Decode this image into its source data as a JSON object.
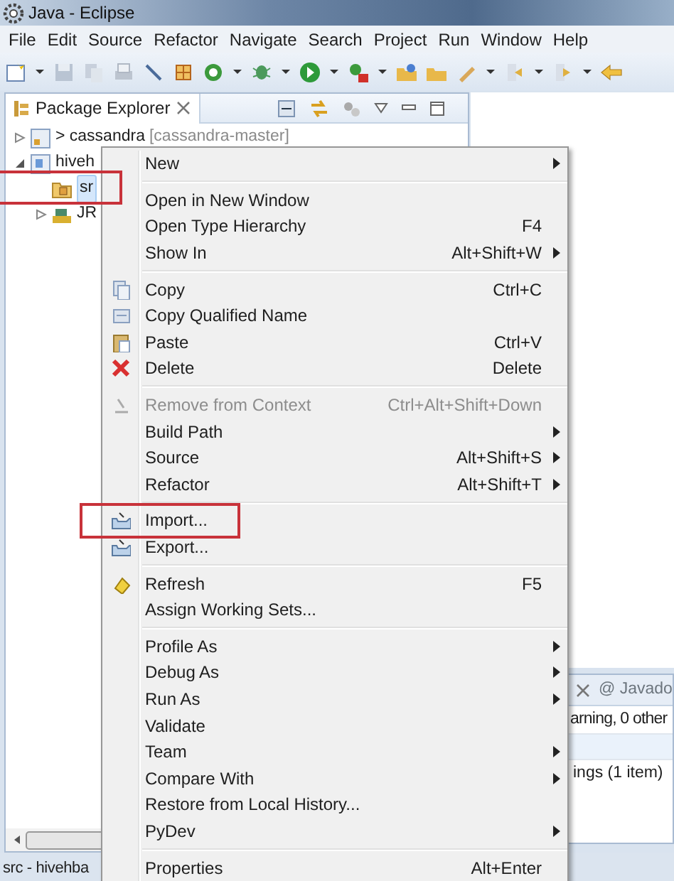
{
  "window": {
    "title": "Java - Eclipse"
  },
  "menu_bar": [
    "File",
    "Edit",
    "Source",
    "Refactor",
    "Navigate",
    "Search",
    "Project",
    "Run",
    "Window",
    "Help"
  ],
  "package_explorer": {
    "title": "Package Explorer",
    "tree": [
      {
        "label": "> cassandra",
        "suffix": "[cassandra-master]",
        "expanded": false,
        "selected": false,
        "highlighted": false
      },
      {
        "label": "hiveh",
        "expanded": true,
        "selected": false,
        "highlighted": false,
        "children": [
          {
            "label": "sr",
            "selected": true,
            "highlighted": true
          },
          {
            "label": "JR",
            "expanded": false,
            "selected": false,
            "highlighted": false
          }
        ]
      }
    ]
  },
  "context_menu": {
    "groups": [
      [
        {
          "label": "New",
          "submenu": true,
          "disabled": false,
          "highlighted": false
        }
      ],
      [
        {
          "label": "Open in New Window",
          "submenu": false,
          "disabled": false,
          "highlighted": false
        },
        {
          "label": "Open Type Hierarchy",
          "shortcut": "F4",
          "submenu": false,
          "disabled": false,
          "highlighted": false
        },
        {
          "label": "Show In",
          "shortcut": "Alt+Shift+W",
          "submenu": true,
          "disabled": false,
          "highlighted": false
        }
      ],
      [
        {
          "label": "Copy",
          "shortcut": "Ctrl+C",
          "submenu": false,
          "disabled": false,
          "highlighted": false
        },
        {
          "label": "Copy Qualified Name",
          "submenu": false,
          "disabled": false,
          "highlighted": false
        },
        {
          "label": "Paste",
          "shortcut": "Ctrl+V",
          "submenu": false,
          "disabled": false,
          "highlighted": false
        },
        {
          "label": "Delete",
          "shortcut": "Delete",
          "submenu": false,
          "disabled": false,
          "highlighted": false
        }
      ],
      [
        {
          "label": "Remove from Context",
          "shortcut": "Ctrl+Alt+Shift+Down",
          "submenu": false,
          "disabled": true,
          "highlighted": false
        },
        {
          "label": "Build Path",
          "submenu": true,
          "disabled": false,
          "highlighted": false
        },
        {
          "label": "Source",
          "shortcut": "Alt+Shift+S",
          "submenu": true,
          "disabled": false,
          "highlighted": false
        },
        {
          "label": "Refactor",
          "shortcut": "Alt+Shift+T",
          "submenu": true,
          "disabled": false,
          "highlighted": false
        }
      ],
      [
        {
          "label": "Import...",
          "submenu": false,
          "disabled": false,
          "highlighted": true
        },
        {
          "label": "Export...",
          "submenu": false,
          "disabled": false,
          "highlighted": false
        }
      ],
      [
        {
          "label": "Refresh",
          "shortcut": "F5",
          "submenu": false,
          "disabled": false,
          "highlighted": false
        },
        {
          "label": "Assign Working Sets...",
          "submenu": false,
          "disabled": false,
          "highlighted": false
        }
      ],
      [
        {
          "label": "Profile As",
          "submenu": true,
          "disabled": false,
          "highlighted": false
        },
        {
          "label": "Debug As",
          "submenu": true,
          "disabled": false,
          "highlighted": false
        },
        {
          "label": "Run As",
          "submenu": true,
          "disabled": false,
          "highlighted": false
        },
        {
          "label": "Validate",
          "submenu": false,
          "disabled": false,
          "highlighted": false
        },
        {
          "label": "Team",
          "submenu": true,
          "disabled": false,
          "highlighted": false
        },
        {
          "label": "Compare With",
          "submenu": true,
          "disabled": false,
          "highlighted": false
        },
        {
          "label": "Restore from Local History...",
          "submenu": false,
          "disabled": false,
          "highlighted": false
        },
        {
          "label": "PyDev",
          "submenu": true,
          "disabled": false,
          "highlighted": false
        }
      ],
      [
        {
          "label": "Properties",
          "shortcut": "Alt+Enter",
          "submenu": false,
          "disabled": false,
          "highlighted": false
        }
      ]
    ]
  },
  "problems_view": {
    "tab_label": "@ Javado",
    "summary": "arning, 0 other",
    "rows": [
      "ings (1 item)"
    ]
  },
  "status_bar": "src - hivehba"
}
